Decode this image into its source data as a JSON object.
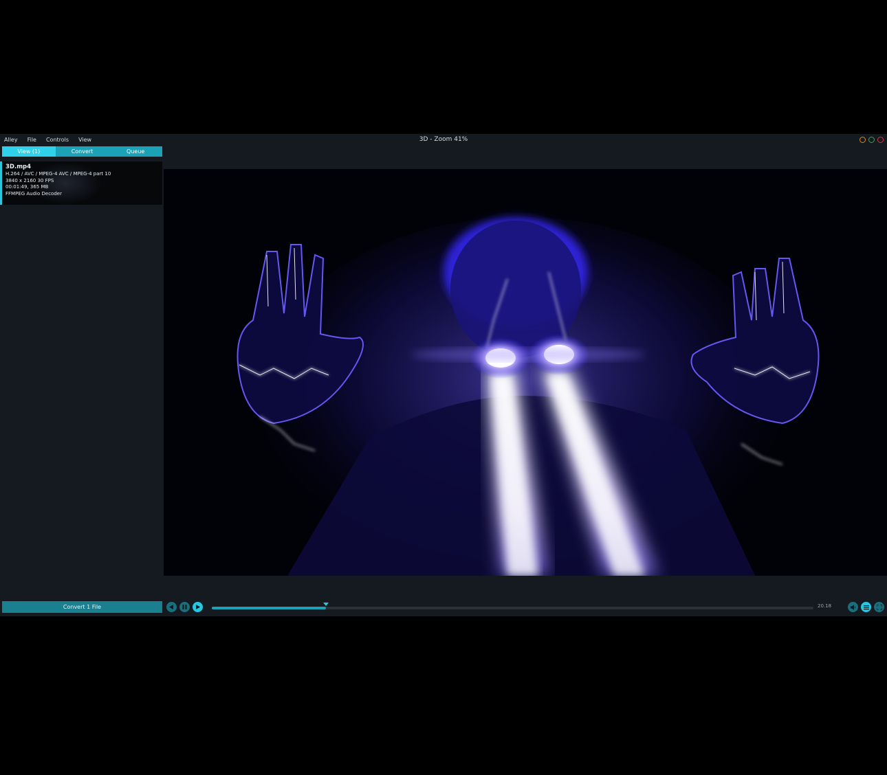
{
  "app": {
    "window_title": "3D - Zoom 41%",
    "menu": [
      "Alley",
      "File",
      "Controls",
      "View"
    ]
  },
  "tabs": [
    {
      "label": "View (1)",
      "active": true
    },
    {
      "label": "Convert",
      "active": false
    },
    {
      "label": "Queue",
      "active": false
    }
  ],
  "file": {
    "name": "3D.mp4",
    "codec": "H.264 / AVC / MPEG-4 AVC / MPEG-4 part 10",
    "resolution": "3840 x 2160 30 FPS",
    "duration_size": "00:01:49, 365 MB",
    "audio": "FFMPEG Audio Decoder"
  },
  "convert_button": "Convert 1 File",
  "playback": {
    "time": "20.18",
    "progress": 0.19,
    "state": "paused"
  },
  "icons": {
    "window_controls": [
      "minimize-icon",
      "maximize-icon",
      "close-icon"
    ],
    "transport": [
      "previous-icon",
      "pause-icon",
      "play-icon"
    ],
    "right": [
      "volume-icon",
      "playlist-icon",
      "fullscreen-icon"
    ]
  },
  "colors": {
    "accent": "#2ed0ea",
    "accent_dark": "#1ba2b6",
    "background": "#141a1f"
  }
}
